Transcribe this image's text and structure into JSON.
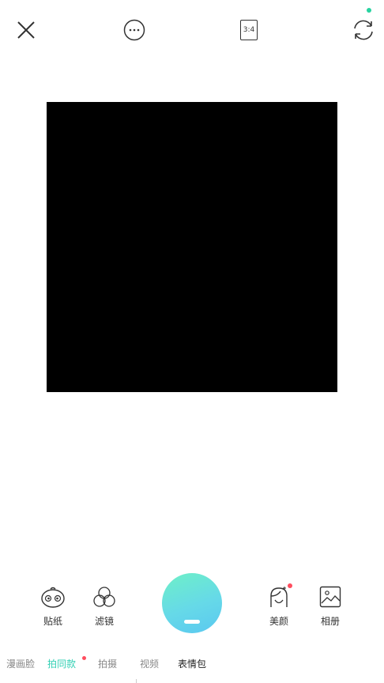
{
  "topbar": {
    "close_icon": "close-icon",
    "more_icon": "more-icon",
    "ratio_label": "3:4",
    "flip_icon": "camera-flip-icon"
  },
  "tools": {
    "sticker": {
      "label": "贴纸",
      "icon": "sticker-face-icon"
    },
    "filter": {
      "label": "滤镜",
      "icon": "filter-circles-icon"
    },
    "beauty": {
      "label": "美颜",
      "icon": "beauty-face-icon"
    },
    "album": {
      "label": "相册",
      "icon": "album-image-icon"
    }
  },
  "modes": [
    {
      "label": "漫画脸"
    },
    {
      "label": "拍同款"
    },
    {
      "label": "拍摄"
    },
    {
      "label": "视频"
    },
    {
      "label": "表情包"
    }
  ],
  "colors": {
    "accent": "#33d0b4",
    "badge": "#ff4d5e",
    "online_dot": "#27d3a0",
    "preview": "#000000"
  }
}
